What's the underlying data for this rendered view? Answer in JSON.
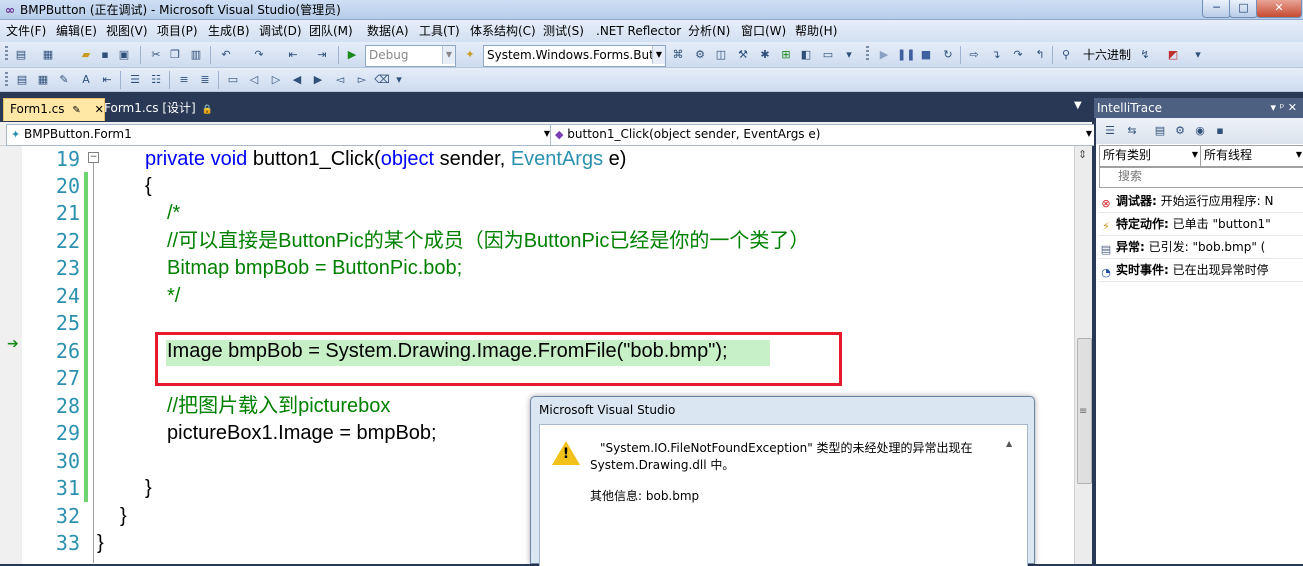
{
  "window": {
    "title": "BMPButton (正在调试) - Microsoft Visual Studio(管理员)",
    "minimize": "─",
    "maximize": "□",
    "close": "✕"
  },
  "menu": [
    "文件(F)",
    "编辑(E)",
    "视图(V)",
    "项目(P)",
    "生成(B)",
    "调试(D)",
    "团队(M)",
    "数据(A)",
    "工具(T)",
    "体系结构(C)",
    "测试(S)",
    ".NET Reflector",
    "分析(N)",
    "窗口(W)",
    "帮助(H)"
  ],
  "toolbar": {
    "config_combo": "Debug",
    "target_combo": "System.Windows.Forms.Buttc",
    "hex_label": "十六进制"
  },
  "tabs": [
    {
      "label": "Form1.cs",
      "pin": "✎",
      "close": "✕"
    },
    {
      "label": "Form1.cs [设计]",
      "lock": "🔒"
    }
  ],
  "nav": {
    "type_combo": "BMPButton.Form1",
    "member_combo": "button1_Click(object sender, EventArgs e)"
  },
  "code": {
    "lines": [
      {
        "num": "19"
      },
      {
        "num": "20"
      },
      {
        "num": "21"
      },
      {
        "num": "22"
      },
      {
        "num": "23"
      },
      {
        "num": "24"
      },
      {
        "num": "25"
      },
      {
        "num": "26"
      },
      {
        "num": "27"
      },
      {
        "num": "28"
      },
      {
        "num": "29"
      },
      {
        "num": "30"
      },
      {
        "num": "31"
      },
      {
        "num": "32"
      },
      {
        "num": "33"
      }
    ],
    "l19": {
      "kw1": "private",
      "kw2": "void",
      "name": "button1_Click(",
      "kw3": "object",
      "p1": "sender,",
      "ty": "EventArgs",
      "p2": "e)"
    },
    "l20": "{",
    "l21": "/*",
    "l22": "//可以直接是ButtonPic的某个成员（因为ButtonPic已经是你的一个类了）",
    "l23": "Bitmap bmpBob = ButtonPic.bob;",
    "l24": "*/",
    "l26": {
      "pre": "Image bmpBob = System.Drawing.Image.FromFile(",
      "str": "\"bob.bmp\"",
      "post": ");"
    },
    "l28": "//把图片载入到picturebox",
    "l29": "pictureBox1.Image = bmpBob;",
    "l31": "}",
    "l32": "}",
    "l33": "}"
  },
  "intellitrace": {
    "title": "IntelliTrace",
    "header_icons": "▾ ᵖ ✕",
    "category_combo": "所有类别",
    "thread_combo": "所有线程",
    "search_placeholder": "搜索",
    "events": [
      {
        "label": "调试器:",
        "text": "开始运行应用程序: N"
      },
      {
        "label": "特定动作:",
        "text": "已单击 \"button1\""
      },
      {
        "label": "异常:",
        "text": "已引发: \"bob.bmp\" ("
      },
      {
        "label": "实时事件:",
        "text": "已在出现异常时停"
      }
    ]
  },
  "dialog": {
    "title": "Microsoft Visual Studio",
    "message_line1": "\"System.IO.FileNotFoundException\" 类型的未经处理的异常出现在",
    "message_line2": "System.Drawing.dll 中。",
    "info": "其他信息: bob.bmp"
  },
  "colors": {
    "chrome": "#293955",
    "keyword": "#0000ff",
    "type": "#2b91af",
    "comment": "#008000",
    "highlight": "#e8192c"
  }
}
